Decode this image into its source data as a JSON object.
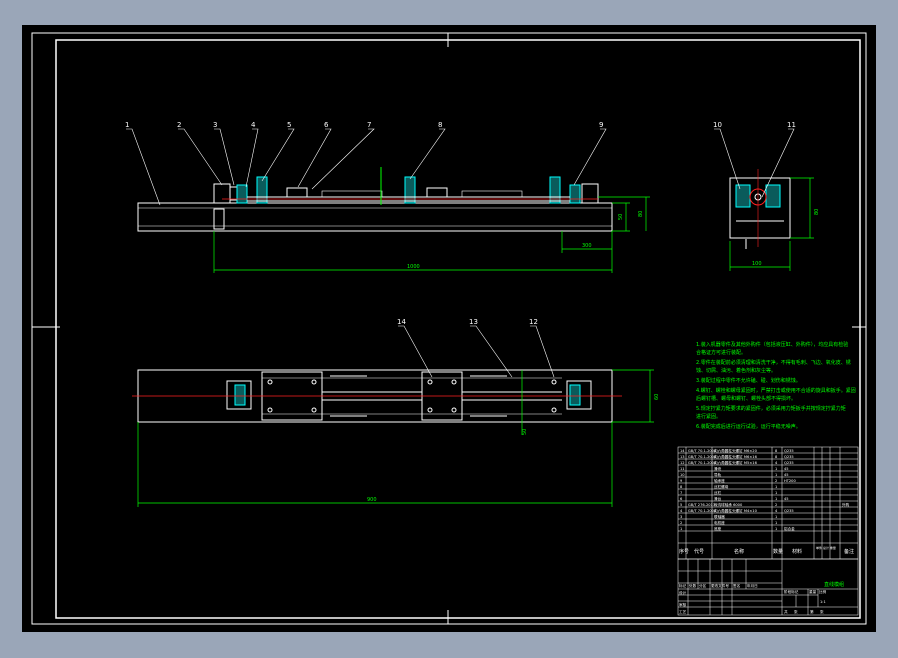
{
  "callouts": {
    "front_top": [
      "1",
      "2",
      "3",
      "4",
      "5",
      "6",
      "7",
      "8",
      "9"
    ],
    "side": [
      "10",
      "11"
    ],
    "plan": [
      "14",
      "13",
      "12"
    ]
  },
  "dimensions": {
    "front_overall": "1000",
    "front_h1": "50",
    "front_h2": "80",
    "front_bottom": "300",
    "side_height": "80",
    "side_width": "100",
    "plan_overall": "900",
    "plan_height": "60",
    "plan_inner": "50"
  },
  "notes": [
    "1.装入机器零件及其他外购件（包括液压缸、外购件），均应具有检验",
    "合格证方可进行装配。",
    "2.零件在装配前必须清理和清洗干净，不得有毛刺、飞边、氧化皮、锈",
    "蚀、切屑、油污、着色剂和灰尘等。",
    "3.装配过程中零件不允许磕、碰、划伤和锈蚀。",
    "4.螺钉、螺栓和螺母紧固时，严禁打击或使用不合适的旋具和扳手。紧固",
    "后螺钉槽、螺母和螺钉、螺栓头部不得损坏。",
    "5.规定拧紧力矩要求的紧固件，必须采用力矩扳手并按规定拧紧力矩",
    "进行紧固。",
    "6.装配完成后进行运行试验，运行平稳无噪声。"
  ],
  "bom": {
    "rows": [
      {
        "no": "14",
        "code": "GB/T 70.1-2008",
        "name": "内六角圆柱头螺钉 M6×20",
        "qty": "8",
        "mat": "Q235",
        "note": ""
      },
      {
        "no": "13",
        "code": "GB/T 70.1-2008",
        "name": "内六角圆柱头螺钉 M6×16",
        "qty": "8",
        "mat": "Q235",
        "note": ""
      },
      {
        "no": "12",
        "code": "GB/T 70.1-2008",
        "name": "内六角圆柱头螺钉 M5×16",
        "qty": "4",
        "mat": "Q235",
        "note": ""
      },
      {
        "no": "11",
        "code": "",
        "name": "滑块",
        "qty": "1",
        "mat": "45",
        "note": ""
      },
      {
        "no": "10",
        "code": "",
        "name": "导轨",
        "qty": "1",
        "mat": "45",
        "note": ""
      },
      {
        "no": "9",
        "code": "",
        "name": "轴承座",
        "qty": "2",
        "mat": "HT200",
        "note": ""
      },
      {
        "no": "8",
        "code": "",
        "name": "丝杠螺母",
        "qty": "1",
        "mat": "",
        "note": ""
      },
      {
        "no": "7",
        "code": "",
        "name": "丝杠",
        "qty": "1",
        "mat": "",
        "note": ""
      },
      {
        "no": "6",
        "code": "",
        "name": "滑台",
        "qty": "1",
        "mat": "45",
        "note": ""
      },
      {
        "no": "5",
        "code": "GB/T 276-2013",
        "name": "深沟球轴承 6000",
        "qty": "2",
        "mat": "",
        "note": "外购"
      },
      {
        "no": "4",
        "code": "GB/T 70.1-2008",
        "name": "内六角圆柱头螺钉 M4×10",
        "qty": "4",
        "mat": "Q235",
        "note": ""
      },
      {
        "no": "3",
        "code": "",
        "name": "联轴器",
        "qty": "1",
        "mat": "",
        "note": ""
      },
      {
        "no": "2",
        "code": "",
        "name": "电机座",
        "qty": "1",
        "mat": "",
        "note": ""
      },
      {
        "no": "1",
        "code": "",
        "name": "底座",
        "qty": "1",
        "mat": "铝合金",
        "note": ""
      }
    ],
    "header": {
      "no": "序号",
      "code": "代号",
      "name": "名称",
      "qty": "数量",
      "mat": "材料",
      "weight": "单件 总计 重量",
      "note": "备注"
    }
  },
  "title_block": {
    "drawing_name": "直线模组",
    "scale": "1:1",
    "labels": [
      "标记",
      "处数",
      "分区",
      "更改文件号",
      "签名",
      "年月日"
    ],
    "rows": [
      "设计",
      "审核",
      "工艺"
    ],
    "stage_labels": [
      "阶段标记",
      "重量",
      "比例"
    ],
    "sheet": [
      "共",
      "张",
      "第",
      "张"
    ]
  },
  "colors": {
    "background": "#000000",
    "frame": "#ffffff",
    "geometry": "#ffffff",
    "dimension": "#00ff00",
    "centerline": "#ff2020",
    "hatch": "#00ffff",
    "text_note": "#00ff00"
  }
}
